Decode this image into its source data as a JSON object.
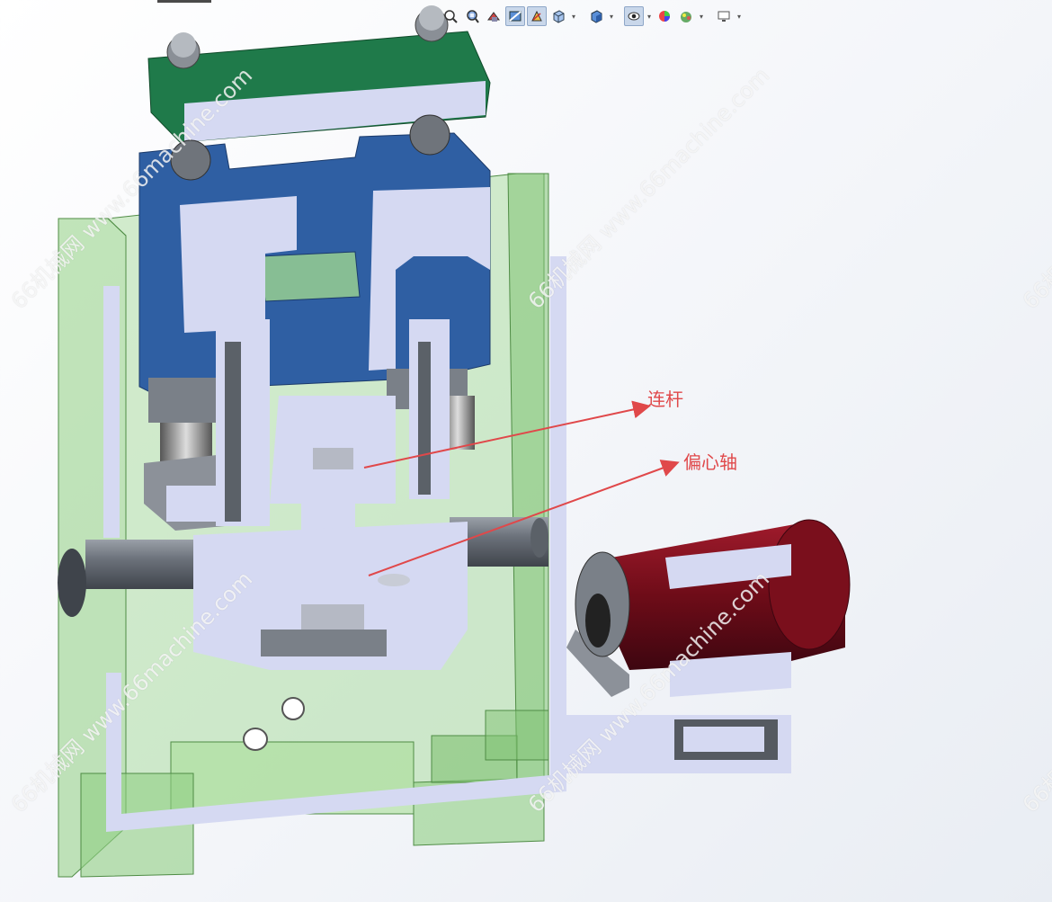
{
  "annotations": {
    "connecting_rod": "连杆",
    "eccentric_shaft": "偏心轴"
  },
  "watermark_text": "66机械网 www.66machine.com",
  "toolbar": {
    "buttons": [
      {
        "icon": "zoom-to-fit-icon"
      },
      {
        "icon": "zoom-to-area-icon"
      },
      {
        "icon": "previous-view-icon"
      },
      {
        "icon": "section-view-icon",
        "active": true
      },
      {
        "icon": "dynamic-annotation-icon",
        "active": true
      },
      {
        "icon": "view-orientation-icon",
        "dropdown": true
      },
      {
        "icon": "display-style-icon",
        "dropdown": true
      },
      {
        "icon": "hide-show-items-icon",
        "active": true,
        "dropdown": true
      },
      {
        "icon": "edit-appearance-icon"
      },
      {
        "icon": "apply-scene-icon",
        "dropdown": true
      },
      {
        "icon": "view-settings-icon",
        "dropdown": true
      }
    ]
  },
  "colors": {
    "frame_green": "#8fcf82",
    "section_face": "#d5d9f2",
    "steel_blue": "#2f5fa3",
    "top_plate_green": "#1f7a4a",
    "motor_red": "#7a0f1c",
    "annotation_red": "#e0484a"
  }
}
